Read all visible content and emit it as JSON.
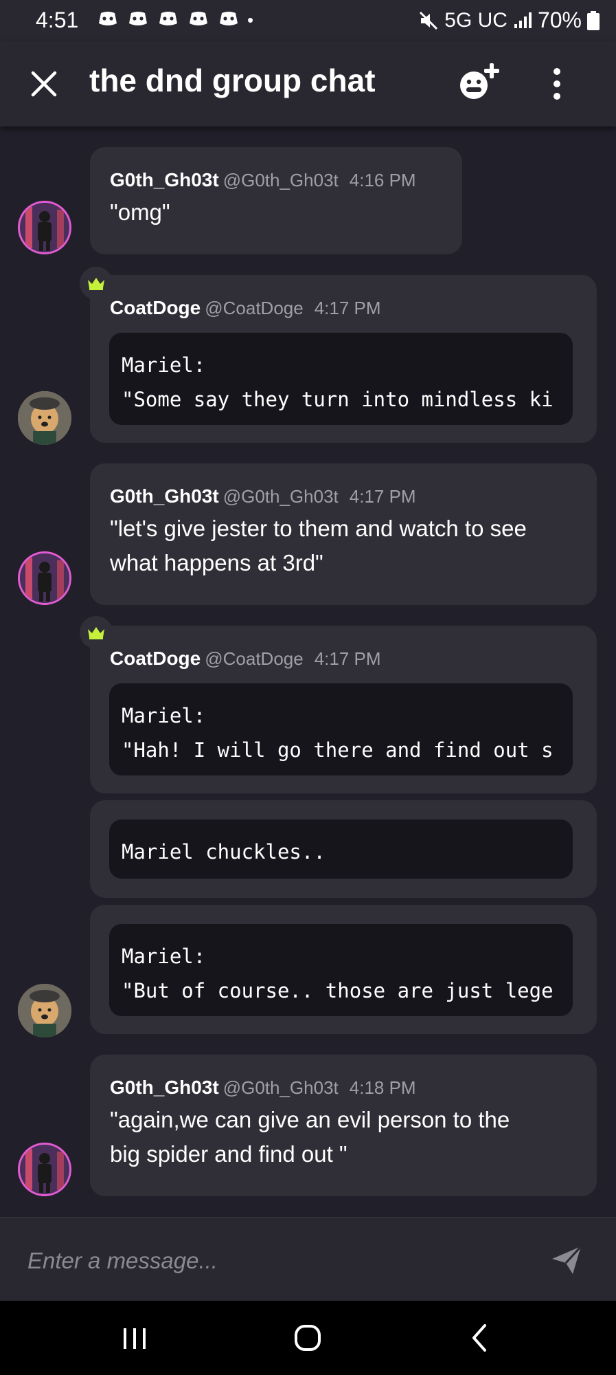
{
  "status_bar": {
    "time": "4:51",
    "notification_icons": [
      "discord-icon",
      "discord-icon",
      "discord-icon",
      "discord-icon",
      "discord-icon"
    ],
    "dot": "•",
    "network": "5G UC",
    "battery": "70%"
  },
  "header": {
    "title": "the dnd group chat"
  },
  "messages": [
    {
      "author": "G0th_Gh03t",
      "handle": "@G0th_Gh03t",
      "time": "4:16 PM",
      "text": "\"omg\""
    },
    {
      "author": "CoatDoge",
      "handle": "@CoatDoge",
      "time": "4:17 PM",
      "code": "Mariel:\n\"Some say they turn into mindless ki"
    },
    {
      "author": "G0th_Gh03t",
      "handle": "@G0th_Gh03t",
      "time": "4:17 PM",
      "text": "\"let's give jester to them and watch to see\nwhat happens at 3rd\""
    },
    {
      "author": "CoatDoge",
      "handle": "@CoatDoge",
      "time": "4:17 PM",
      "code": "Mariel:\n\"Hah! I will go there and find out s"
    },
    {
      "code": "Mariel chuckles.."
    },
    {
      "code": "Mariel:\n\"But of course.. those are just lege"
    },
    {
      "author": "G0th_Gh03t",
      "handle": "@G0th_Gh03t",
      "time": "4:18 PM",
      "text": "\"again,we can give an evil person to the\nbig spider and find out \""
    }
  ],
  "composer": {
    "placeholder": "Enter a message..."
  },
  "colors": {
    "background": "#211f2a",
    "bubble": "#302e36",
    "code_block": "#16151c",
    "crown": "#c6f13a",
    "avatar_ring": "#e25bd2"
  }
}
